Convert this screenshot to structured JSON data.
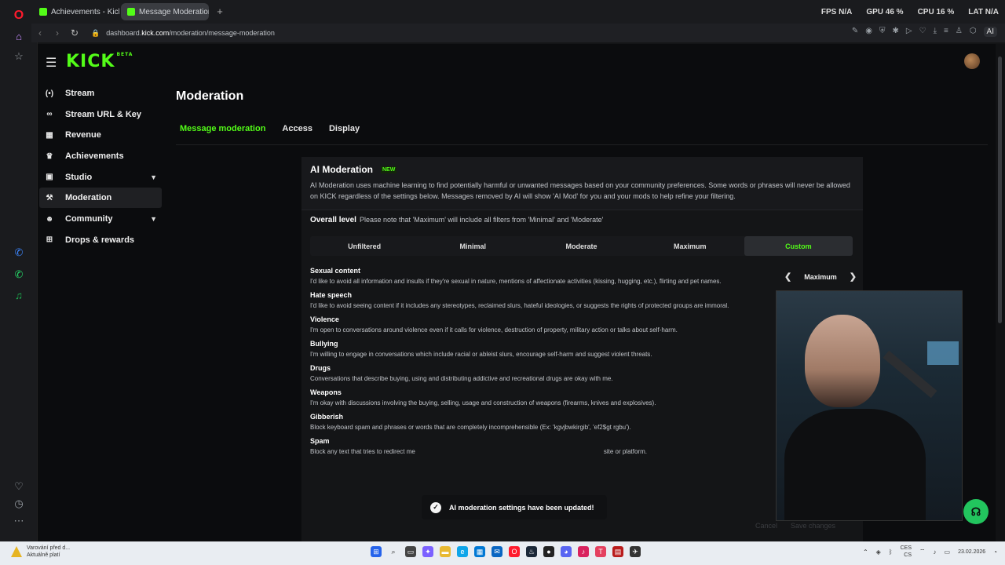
{
  "browser": {
    "tabs": [
      {
        "label": "Achievements - Kick Dash",
        "active": false
      },
      {
        "label": "Message Moderation - Ki",
        "active": true
      }
    ],
    "url_prefix": "dashboard.",
    "url_domain": "kick.com",
    "url_path": "/moderation/message-moderation",
    "stats": {
      "fps_label": "FPS",
      "fps": "N/A",
      "gpu_label": "GPU",
      "gpu": "46 %",
      "cpu_label": "CPU",
      "cpu": "16 %",
      "lat_label": "LAT",
      "lat": "N/A"
    },
    "ai_label": "AI"
  },
  "kick": {
    "logo": "KICK",
    "logo_sup": "BETA"
  },
  "sidebar": {
    "items": [
      {
        "label": "Stream",
        "icon": "broadcast-icon",
        "glyph": "(•)",
        "active": false,
        "expandable": false
      },
      {
        "label": "Stream URL & Key",
        "icon": "link-icon",
        "glyph": "∞",
        "active": false,
        "expandable": false
      },
      {
        "label": "Revenue",
        "icon": "chart-icon",
        "glyph": "▦",
        "active": false,
        "expandable": false
      },
      {
        "label": "Achievements",
        "icon": "trophy-icon",
        "glyph": "♛",
        "active": false,
        "expandable": false
      },
      {
        "label": "Studio",
        "icon": "video-icon",
        "glyph": "▣",
        "active": false,
        "expandable": true
      },
      {
        "label": "Moderation",
        "icon": "hammer-icon",
        "glyph": "⚒",
        "active": true,
        "expandable": false
      },
      {
        "label": "Community",
        "icon": "people-icon",
        "glyph": "☻",
        "active": false,
        "expandable": true
      },
      {
        "label": "Drops & rewards",
        "icon": "gift-icon",
        "glyph": "⊞",
        "active": false,
        "expandable": false
      }
    ]
  },
  "main": {
    "title": "Moderation",
    "tabs": [
      {
        "label": "Message moderation",
        "active": true
      },
      {
        "label": "Access",
        "active": false
      },
      {
        "label": "Display",
        "active": false
      }
    ]
  },
  "ai": {
    "title": "AI Moderation",
    "badge": "NEW",
    "description": "AI Moderation uses machine learning to find potentially harmful or unwanted messages based on your community preferences. Some words or phrases will never be allowed on KICK regardless of the settings below. Messages removed by AI will show 'AI Mod' for you and your mods to help refine your filtering.",
    "overall_label": "Overall level",
    "overall_note": "Please note that 'Maximum' will include all filters from 'Minimal' and 'Moderate'",
    "levels": [
      {
        "label": "Unfiltered",
        "active": false
      },
      {
        "label": "Minimal",
        "active": false
      },
      {
        "label": "Moderate",
        "active": false
      },
      {
        "label": "Maximum",
        "active": false
      },
      {
        "label": "Custom",
        "active": true
      }
    ],
    "categories": [
      {
        "name": "Sexual content",
        "desc": "I'd like to avoid all information and insults if they're sexual in nature, mentions of affectionate activities (kissing, hugging, etc.), flirting and pet names.",
        "value": "Maximum"
      },
      {
        "name": "Hate speech",
        "desc": "I'd like to avoid seeing content if it includes any stereotypes, reclaimed slurs, hateful ideologies, or suggests the rights of protected groups are immoral.",
        "value": ""
      },
      {
        "name": "Violence",
        "desc": "I'm open to conversations around violence even if it calls for violence, destruction of property, military action or talks about self-harm.",
        "value": ""
      },
      {
        "name": "Bullying",
        "desc": "I'm willing to engage in conversations which include racial or ableist slurs, encourage self-harm and suggest violent threats.",
        "value": ""
      },
      {
        "name": "Drugs",
        "desc": "Conversations that describe buying, using and distributing addictive and recreational drugs are okay with me.",
        "value": ""
      },
      {
        "name": "Weapons",
        "desc": "I'm okay with discussions involving the buying, selling, usage and construction of weapons (firearms, knives and explosives).",
        "value": ""
      },
      {
        "name": "Gibberish",
        "desc": "Block keyboard spam and phrases or words that are completely incomprehensible (Ex: 'kgvjbwkirgib', 'ef2$gt rgbu').",
        "value": ""
      },
      {
        "name": "Spam",
        "desc": "Block any text that tries to redirect me",
        "desc_tail": "site or platform.",
        "value": ""
      }
    ],
    "cancel_label": "Cancel",
    "save_label": "Save changes"
  },
  "toast": {
    "message": "AI moderation settings have been updated!"
  },
  "taskbar": {
    "notice_line1": "Varování před d...",
    "notice_line2": "Aktuálně platí",
    "lang1": "CES",
    "lang2": "CS",
    "date": "23.02.2026"
  },
  "colors": {
    "accent": "#53fc18",
    "background": "#0b0c0e",
    "card": "#141517"
  }
}
